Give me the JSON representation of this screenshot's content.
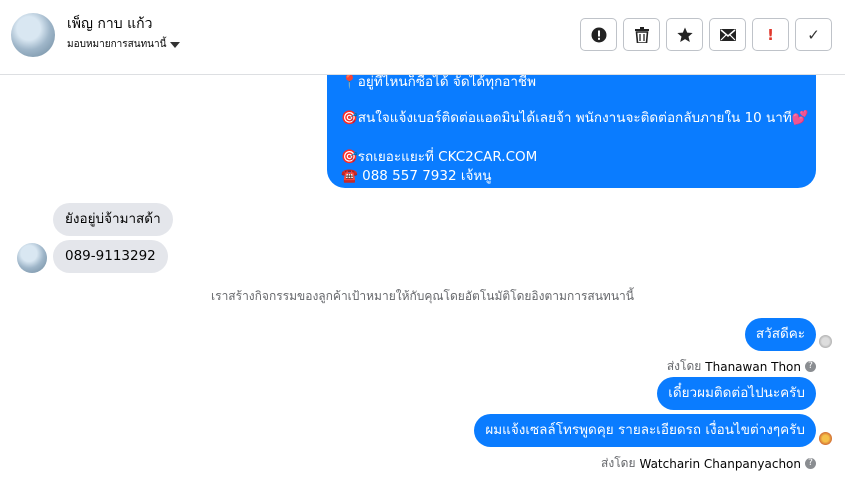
{
  "contact": {
    "name": "เพ็ญ กาบ แก้ว",
    "assign_label": "มอบหมายการสนทนานี้"
  },
  "toolbar": {
    "alert": "!",
    "check": "✓"
  },
  "messages": {
    "outgoing_block": [
      "📍อยู่ที่ไหนก็ซื้อได้ จัดได้ทุกอาชีพ",
      "🎯สนใจแจ้งเบอร์ติดต่อแอดมินได้เลยจ้า พนักงานจะติดต่อกลับภายใน 10 นาที💕",
      "🎯รถเยอะแยะที่ CKC2CAR.COM",
      "☎️ 088 557 7932 เจ้หนู"
    ],
    "incoming_1": "ยังอยู่บ่จ้ามาสด้า",
    "incoming_2": "089-9113292",
    "system_note": "เราสร้างกิจกรรมของลูกค้าเป้าหมายให้กับคุณโดยอัตโนมัติโดยอิงตามการสนทนานี้",
    "out_1": "สวัสดีคะ",
    "sent_by_label": "ส่งโดย",
    "sender_1": "Thanawan Thon",
    "out_2": "เดี๋ยวผมติดต่อไปนะครับ",
    "out_3": "ผมแจ้งเซลล์โทรพูดคุย รายละเอียดรถ เงื่อนไขต่างๆครับ",
    "sender_2": "Watcharin Chanpanyachon",
    "help_glyph": "?"
  },
  "colors": {
    "accent": "#0a7cff",
    "incoming_bg": "#e4e6eb",
    "alert": "#e0372c"
  }
}
